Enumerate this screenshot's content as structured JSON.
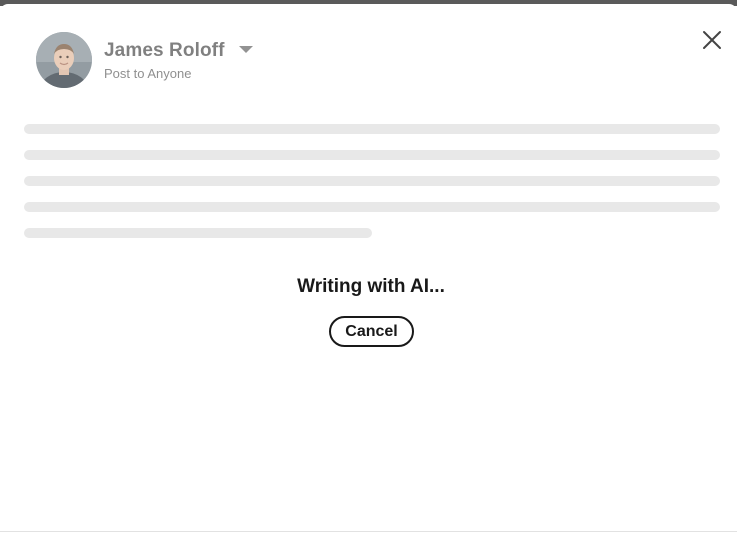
{
  "composer": {
    "author_name": "James Roloff",
    "audience_label": "Post to Anyone"
  },
  "icons": {
    "close": "close-icon",
    "audience_dropdown": "caret-down-icon",
    "avatar": "profile-photo"
  },
  "status": {
    "message": "Writing with AI...",
    "cancel_label": "Cancel"
  }
}
